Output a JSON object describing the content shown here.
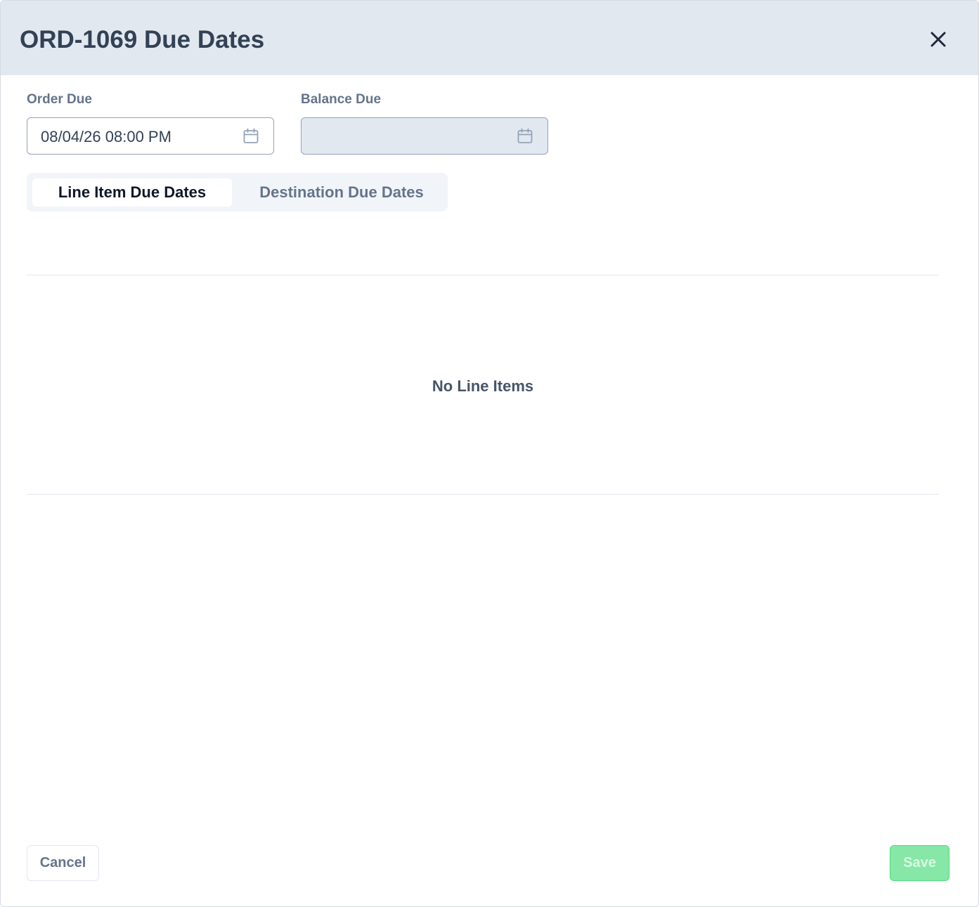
{
  "dialog": {
    "title": "ORD-1069 Due Dates",
    "close_icon": "close-icon"
  },
  "order_due": {
    "label": "Order Due",
    "value": "08/04/26 08:00 PM",
    "icon": "calendar-icon"
  },
  "balance_due": {
    "label": "Balance Due",
    "value": "",
    "disabled": true,
    "icon": "calendar-icon"
  },
  "tabs": [
    {
      "label": "Line Item Due Dates",
      "active": true
    },
    {
      "label": "Destination Due Dates",
      "active": false
    }
  ],
  "line_items": {
    "empty_message": "No Line Items"
  },
  "footer": {
    "cancel_label": "Cancel",
    "save_label": "Save",
    "save_disabled": true
  },
  "colors": {
    "header_bg": "#e2e8f0",
    "save_bg": "#86e7a6",
    "title_text": "#334155"
  }
}
